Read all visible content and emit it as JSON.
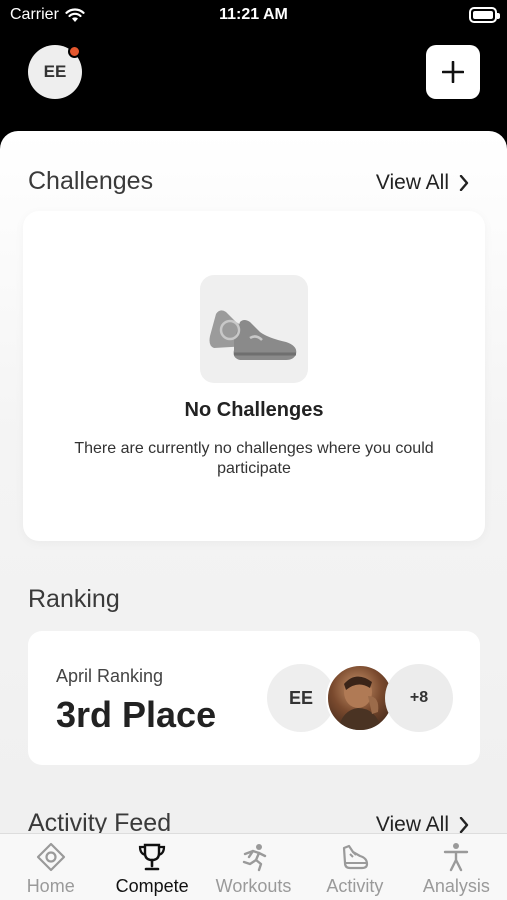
{
  "status_bar": {
    "carrier": "Carrier",
    "time": "11:21 AM"
  },
  "header": {
    "avatar_initials": "EE"
  },
  "challenges": {
    "title": "Challenges",
    "view_all": "View All",
    "empty_title": "No Challenges",
    "empty_description": "There are currently no challenges where you could participate"
  },
  "ranking": {
    "title": "Ranking",
    "label": "April Ranking",
    "place": "3rd Place",
    "participants": {
      "first_initials": "EE",
      "more_count": "+8"
    }
  },
  "activity_feed": {
    "title": "Activity Feed",
    "view_all": "View All"
  },
  "tabs": [
    {
      "label": "Home",
      "icon": "home-diamond-icon",
      "active": false
    },
    {
      "label": "Compete",
      "icon": "trophy-icon",
      "active": true
    },
    {
      "label": "Workouts",
      "icon": "runner-icon",
      "active": false
    },
    {
      "label": "Activity",
      "icon": "shoe-icon",
      "active": false
    },
    {
      "label": "Analysis",
      "icon": "person-icon",
      "active": false
    }
  ],
  "colors": {
    "notification_dot": "#e4572e",
    "active_tab": "#111111",
    "inactive_tab": "#9a9a9a"
  }
}
